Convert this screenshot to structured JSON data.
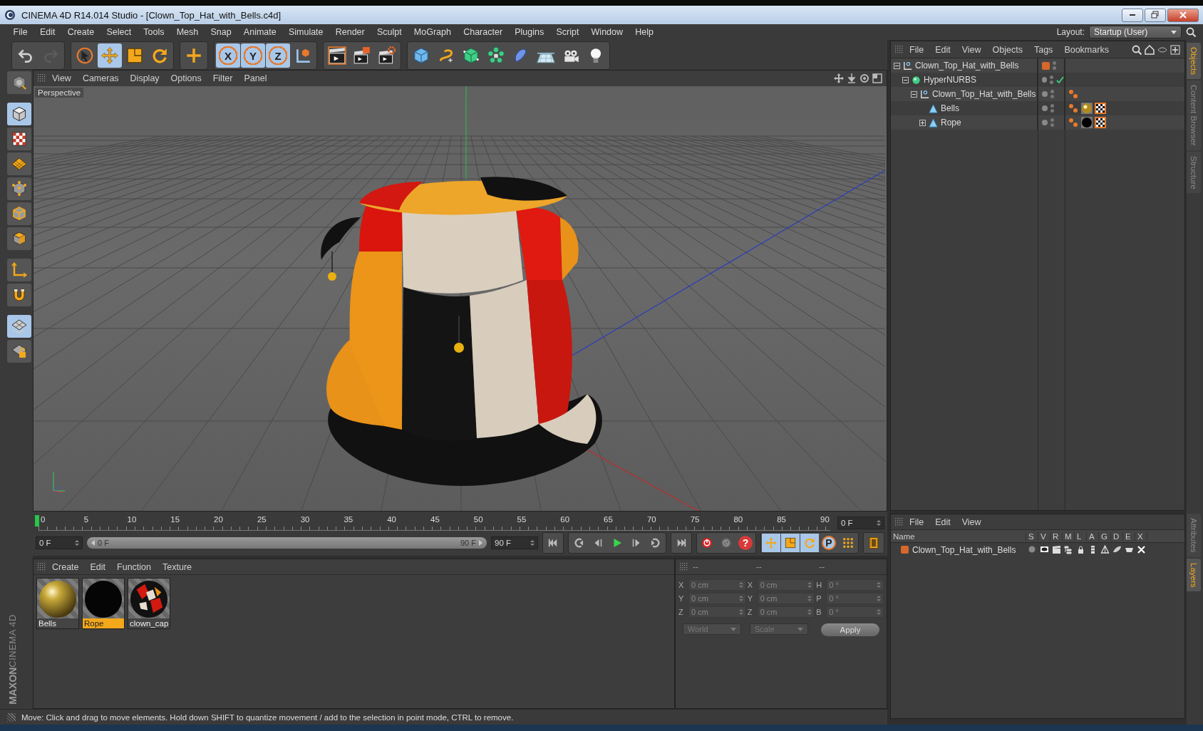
{
  "window": {
    "title": "CINEMA 4D R14.014 Studio - [Clown_Top_Hat_with_Bells.c4d]"
  },
  "menu": [
    "File",
    "Edit",
    "Create",
    "Select",
    "Tools",
    "Mesh",
    "Snap",
    "Animate",
    "Simulate",
    "Render",
    "Sculpt",
    "MoGraph",
    "Character",
    "Plugins",
    "Script",
    "Window",
    "Help"
  ],
  "layout": {
    "label": "Layout:",
    "value": "Startup (User)"
  },
  "toolbar": [
    {
      "tools": [
        {
          "kind": "undo",
          "selected": false,
          "disabled": false
        },
        {
          "kind": "redo",
          "selected": false,
          "disabled": true
        }
      ]
    },
    {
      "tools": [
        {
          "kind": "select",
          "selected": false,
          "disabled": false
        },
        {
          "kind": "move",
          "selected": true,
          "disabled": false
        },
        {
          "kind": "scale",
          "selected": false,
          "disabled": false
        },
        {
          "kind": "rotate",
          "selected": false,
          "disabled": false
        }
      ]
    },
    {
      "tools": [
        {
          "kind": "add",
          "selected": false,
          "disabled": false
        }
      ]
    },
    {
      "tools": [
        {
          "kind": "axis",
          "label": "X",
          "selected": true,
          "disabled": false
        },
        {
          "kind": "axis",
          "label": "Y",
          "selected": true,
          "disabled": false
        },
        {
          "kind": "axis",
          "label": "Z",
          "selected": true,
          "disabled": false
        },
        {
          "kind": "coordinates",
          "selected": false,
          "disabled": false
        }
      ]
    },
    {
      "tools": [
        {
          "kind": "renderview",
          "selected": false,
          "disabled": false
        },
        {
          "kind": "render",
          "selected": false,
          "disabled": false
        },
        {
          "kind": "rendersettings",
          "selected": false,
          "disabled": false
        }
      ]
    },
    {
      "tools": [
        {
          "kind": "cube",
          "selected": false,
          "disabled": false
        },
        {
          "kind": "spline",
          "selected": false,
          "disabled": false
        },
        {
          "kind": "nurbs",
          "selected": false,
          "disabled": false
        },
        {
          "kind": "array",
          "selected": false,
          "disabled": false
        },
        {
          "kind": "deformer",
          "selected": false,
          "disabled": false
        },
        {
          "kind": "floor",
          "selected": false,
          "disabled": false
        },
        {
          "kind": "camera",
          "selected": false,
          "disabled": false
        },
        {
          "kind": "light",
          "selected": false,
          "disabled": false
        }
      ]
    }
  ],
  "left_tools": [
    {
      "kind": "makeeditable",
      "selected": false
    },
    {
      "kind": "model",
      "selected": true
    },
    {
      "kind": "texture",
      "selected": false
    },
    {
      "kind": "workplane",
      "selected": false
    },
    {
      "kind": "points",
      "selected": false
    },
    {
      "kind": "edges",
      "selected": false
    },
    {
      "kind": "polygons",
      "selected": false
    },
    {
      "kind": "axes",
      "selected": false
    },
    {
      "kind": "magnet",
      "selected": false
    },
    {
      "kind": "snap",
      "selected": true
    },
    {
      "kind": "locksnap",
      "selected": false
    }
  ],
  "viewport": {
    "menu": [
      "View",
      "Cameras",
      "Display",
      "Options",
      "Filter",
      "Panel"
    ],
    "camera_label": "Perspective"
  },
  "object_manager": {
    "menu": [
      "File",
      "Edit",
      "View",
      "Objects",
      "Tags",
      "Bookmarks"
    ],
    "objects": [
      {
        "name": "Clown_Top_Hat_with_Bells",
        "kind": "null",
        "expanded": true,
        "color": "#d8672b",
        "children": [
          {
            "name": "HyperNURBS",
            "kind": "nurbs",
            "expanded": true,
            "enabled": true,
            "children": [
              {
                "name": "Clown_Top_Hat_with_Bells",
                "kind": "null",
                "expanded": true,
                "tags": [
                  {
                    "kind": "phong"
                  }
                ],
                "children": [
                  {
                    "name": "Bells",
                    "kind": "polygon",
                    "tags": [
                      {
                        "kind": "phong"
                      },
                      {
                        "kind": "gold"
                      },
                      {
                        "kind": "uvw"
                      }
                    ]
                  },
                  {
                    "name": "Rope",
                    "kind": "polygon",
                    "expanded": false,
                    "tags": [
                      {
                        "kind": "phong"
                      },
                      {
                        "kind": "black"
                      },
                      {
                        "kind": "uvw"
                      }
                    ]
                  }
                ]
              }
            ]
          }
        ]
      }
    ]
  },
  "side_tabs": [
    {
      "label": "Objects",
      "selected": true
    },
    {
      "label": "Content Browser",
      "selected": false
    },
    {
      "label": "Structure",
      "selected": false
    }
  ],
  "timeline": {
    "ticks": [
      "0",
      "5",
      "10",
      "15",
      "20",
      "25",
      "30",
      "35",
      "40",
      "45",
      "50",
      "55",
      "60",
      "65",
      "70",
      "75",
      "80",
      "85",
      "90"
    ],
    "playhead": {
      "level": 0
    },
    "current_frame": "0 F",
    "start_frame": "0 F",
    "range": {
      "start": "0 F",
      "end": "90 F",
      "level": 1
    },
    "end_frame": "90 F",
    "controls": [
      {
        "kind": "first"
      },
      {
        "kind": "prevkey"
      },
      {
        "kind": "prevframe"
      },
      {
        "kind": "play"
      },
      {
        "kind": "nextframe"
      },
      {
        "kind": "nextkey"
      },
      {
        "kind": "last"
      },
      {
        "kind": "record"
      },
      {
        "kind": "autokey"
      },
      {
        "kind": "keyset",
        "label": "?"
      },
      {
        "kind": "keymove"
      },
      {
        "kind": "keyscale"
      },
      {
        "kind": "keyrotate"
      },
      {
        "kind": "keyparam",
        "label": "P"
      },
      {
        "kind": "keypoints"
      },
      {
        "kind": "film"
      }
    ]
  },
  "materials": {
    "menu": [
      "Create",
      "Edit",
      "Function",
      "Texture"
    ],
    "items": [
      {
        "name": "Bells",
        "kind": "gold",
        "selected": false
      },
      {
        "name": "Rope",
        "kind": "black",
        "selected": true
      },
      {
        "name": "clown_cap",
        "kind": "patchwork",
        "selected": false
      }
    ]
  },
  "coordinates": {
    "headers": [
      "--",
      "--",
      "--"
    ],
    "rows": [
      {
        "axes": [
          "X",
          "X",
          "H"
        ],
        "values": [
          "0 cm",
          "0 cm",
          "0 °"
        ]
      },
      {
        "axes": [
          "Y",
          "Y",
          "P"
        ],
        "values": [
          "0 cm",
          "0 cm",
          "0 °"
        ]
      },
      {
        "axes": [
          "Z",
          "Z",
          "B"
        ],
        "values": [
          "0 cm",
          "0 cm",
          "0 °"
        ]
      }
    ],
    "mode": "World",
    "transform": "Scale",
    "apply": "Apply"
  },
  "layer_manager": {
    "menu": [
      "File",
      "Edit",
      "View"
    ],
    "columns": [
      "Name",
      "S",
      "V",
      "R",
      "M",
      "L",
      "A",
      "G",
      "D",
      "E",
      "X"
    ],
    "layers": [
      {
        "name": "Clown_Top_Hat_with_Bells",
        "color": "#d8672b"
      }
    ]
  },
  "lower_side_tabs": [
    {
      "label": "Attributes",
      "selected": false
    },
    {
      "label": "Layers",
      "selected": true
    }
  ],
  "logo": {
    "brand": "MAXON",
    "product": "CINEMA 4D"
  },
  "status_bar": "Move: Click and drag to move elements. Hold down SHIFT to quantize movement / add to the selection in point mode, CTRL to remove."
}
